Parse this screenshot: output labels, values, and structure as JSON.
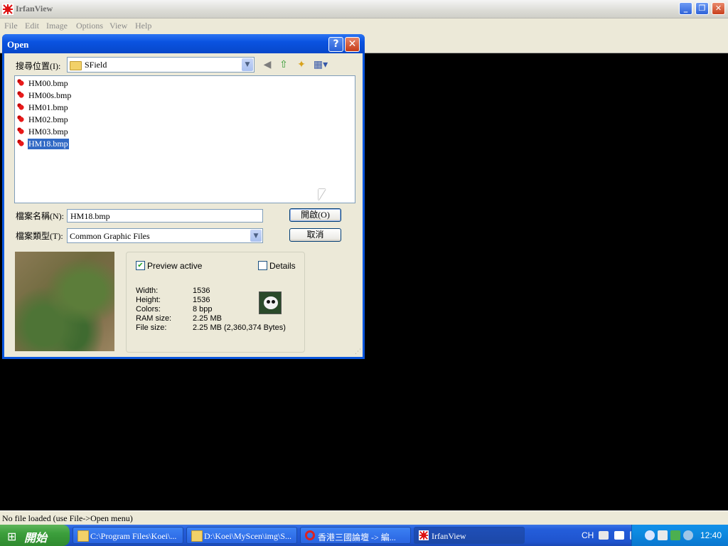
{
  "window": {
    "title": "IrfanView",
    "controls": {
      "minimize": "_",
      "restore": "❐",
      "close": "✕"
    }
  },
  "menu": [
    "File",
    "Edit",
    "Image",
    "Options",
    "View",
    "Help"
  ],
  "status_text": "No file loaded  (use File->Open menu)",
  "dialog": {
    "title": "Open",
    "help_label": "?",
    "close_label": "✕",
    "look_in_label": "搜尋位置(I):",
    "look_in_value": "SField",
    "files": [
      {
        "name": "HM00.bmp",
        "selected": false
      },
      {
        "name": "HM00s.bmp",
        "selected": false
      },
      {
        "name": "HM01.bmp",
        "selected": false
      },
      {
        "name": "HM02.bmp",
        "selected": false
      },
      {
        "name": "HM03.bmp",
        "selected": false
      },
      {
        "name": "HM18.bmp",
        "selected": true
      }
    ],
    "filename_label": "檔案名稱(N):",
    "filename_value": "HM18.bmp",
    "filetype_label": "檔案類型(T):",
    "filetype_value": "Common Graphic Files",
    "open_button": "開啟(O)",
    "cancel_button": "取消",
    "preview_label": "Preview active",
    "preview_checked": true,
    "details_label": "Details",
    "details_checked": false,
    "info": [
      {
        "label": "Width:",
        "value": "1536"
      },
      {
        "label": "Height:",
        "value": "1536"
      },
      {
        "label": "Colors:",
        "value": "8 bpp"
      },
      {
        "label": "RAM size:",
        "value": "2.25 MB"
      },
      {
        "label": "File size:",
        "value": "2.25 MB (2,360,374 Bytes)"
      }
    ]
  },
  "taskbar": {
    "start_label": "開始",
    "tasks": [
      {
        "label": "C:\\Program Files\\Koei\\...",
        "icon": "folder-icon",
        "active": false
      },
      {
        "label": "D:\\Koei\\MyScen\\img\\S...",
        "icon": "folder-icon",
        "active": false
      },
      {
        "label": "香港三國論壇 -> 編...",
        "icon": "opera-icon",
        "active": false
      },
      {
        "label": "IrfanView",
        "icon": "irfanview-icon",
        "active": true
      }
    ],
    "language": "CH",
    "clock": "12:40"
  },
  "colors": {
    "accent": "#0a53e1",
    "selection": "#316ac5",
    "taskbar": "#245edb",
    "start": "#3c9f3c"
  }
}
